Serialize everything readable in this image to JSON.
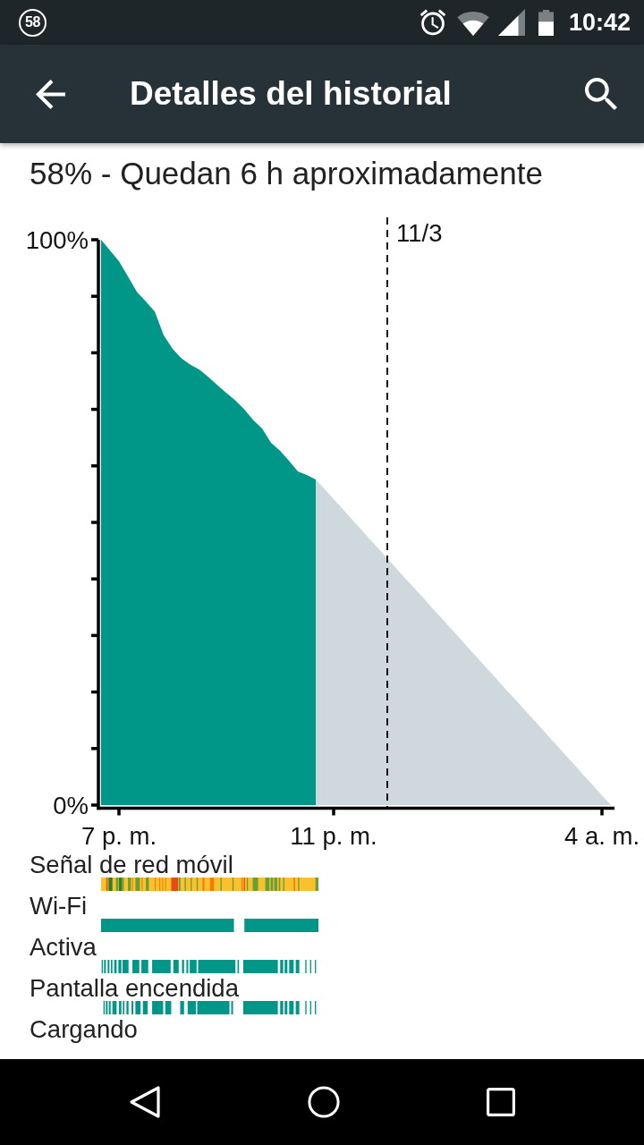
{
  "status_bar": {
    "notification_badge": "58",
    "time": "10:42"
  },
  "app_bar": {
    "title": "Detalles del historial"
  },
  "summary": "58% - Quedan 6 h aproximadamente",
  "battery_chart": {
    "date_marker": "11/3",
    "chart_data": {
      "type": "area",
      "categories": [
        null,
        null,
        "7 p. m.",
        null,
        null,
        null,
        null,
        null,
        null,
        null,
        null,
        null,
        null,
        null,
        null,
        null,
        null,
        null,
        null,
        null,
        null,
        null,
        null,
        null,
        null,
        null,
        "11 p. m.",
        null,
        null,
        null,
        null,
        null,
        null,
        null,
        null,
        null,
        null,
        null,
        null,
        null,
        null,
        null,
        null,
        null,
        null,
        null,
        null,
        null,
        null,
        null,
        null,
        null,
        null,
        null,
        null,
        null,
        "4 a. m.",
        null
      ],
      "series": [
        {
          "color": "#009688",
          "values": [
            100,
            98.1,
            96.2,
            93.5,
            90.8,
            89.1,
            87.3,
            83.1,
            80.7,
            79,
            77.9,
            77,
            75.7,
            74.3,
            72.9,
            71.6,
            70,
            68.1,
            66.6,
            64.1,
            62.7,
            60.9,
            59,
            58.4,
            57.6,
            null,
            null,
            null,
            null,
            null,
            null,
            null,
            null,
            null,
            null,
            null,
            null,
            null,
            null,
            null,
            null,
            null,
            null,
            null,
            null,
            null,
            null,
            null,
            null,
            null,
            null,
            null,
            null,
            null,
            null,
            null,
            null,
            null
          ]
        },
        {
          "color": "#cfd8dc",
          "values": [
            null,
            null,
            null,
            null,
            null,
            null,
            null,
            null,
            null,
            null,
            null,
            null,
            null,
            null,
            null,
            null,
            null,
            null,
            null,
            null,
            null,
            null,
            null,
            null,
            57.6,
            55.9,
            54.1,
            52.4,
            50.6,
            48.9,
            47.1,
            45.4,
            43.6,
            41.9,
            40.1,
            38.4,
            36.7,
            34.9,
            33.2,
            31.4,
            29.7,
            27.9,
            26.2,
            24.4,
            22.7,
            20.9,
            19.2,
            17.5,
            15.7,
            14,
            12.2,
            10.5,
            8.7,
            7,
            5.2,
            3.5,
            1.7,
            0
          ]
        }
      ],
      "ylim": [
        0,
        100
      ],
      "yticks": [
        {
          "value": 0,
          "label": "0%"
        },
        {
          "value": 100,
          "label": "100%"
        }
      ]
    }
  },
  "history_rows": [
    {
      "label": "Señal de red móvil",
      "kind": "signal"
    },
    {
      "label": "Wi-Fi",
      "kind": "wifi"
    },
    {
      "label": "Activa",
      "kind": "awake"
    },
    {
      "label": "Pantalla encendida",
      "kind": "screen"
    },
    {
      "label": "Cargando",
      "kind": "plain"
    }
  ]
}
